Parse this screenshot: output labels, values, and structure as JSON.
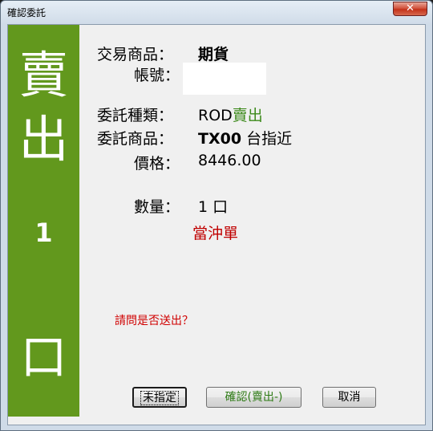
{
  "window": {
    "title": "確認委託",
    "close_glyph": "✕"
  },
  "panel": {
    "line1": "賣",
    "line2": "出",
    "qty": "1",
    "unit": "口"
  },
  "fields": {
    "product_type": {
      "label": "交易商品：",
      "value": "期貨"
    },
    "account": {
      "label": "帳號："
    },
    "order_type": {
      "label": "委託種類：",
      "prefix": "ROD",
      "side": "賣出"
    },
    "order_product": {
      "label": "委託商品：",
      "code": "TX00",
      "name": "台指近"
    },
    "price": {
      "label": "價格：",
      "value": "8446.00"
    },
    "quantity": {
      "label": "數量：",
      "value": "1 口"
    },
    "day_trade": "當沖單"
  },
  "question": "請問是否送出？",
  "buttons": {
    "unspecified": "未指定",
    "confirm": "確認(賣出-)",
    "cancel": "取消"
  },
  "colors": {
    "panel_green": "#62981d",
    "sell_green": "#3d8a1c",
    "alert_red": "#c00000"
  }
}
